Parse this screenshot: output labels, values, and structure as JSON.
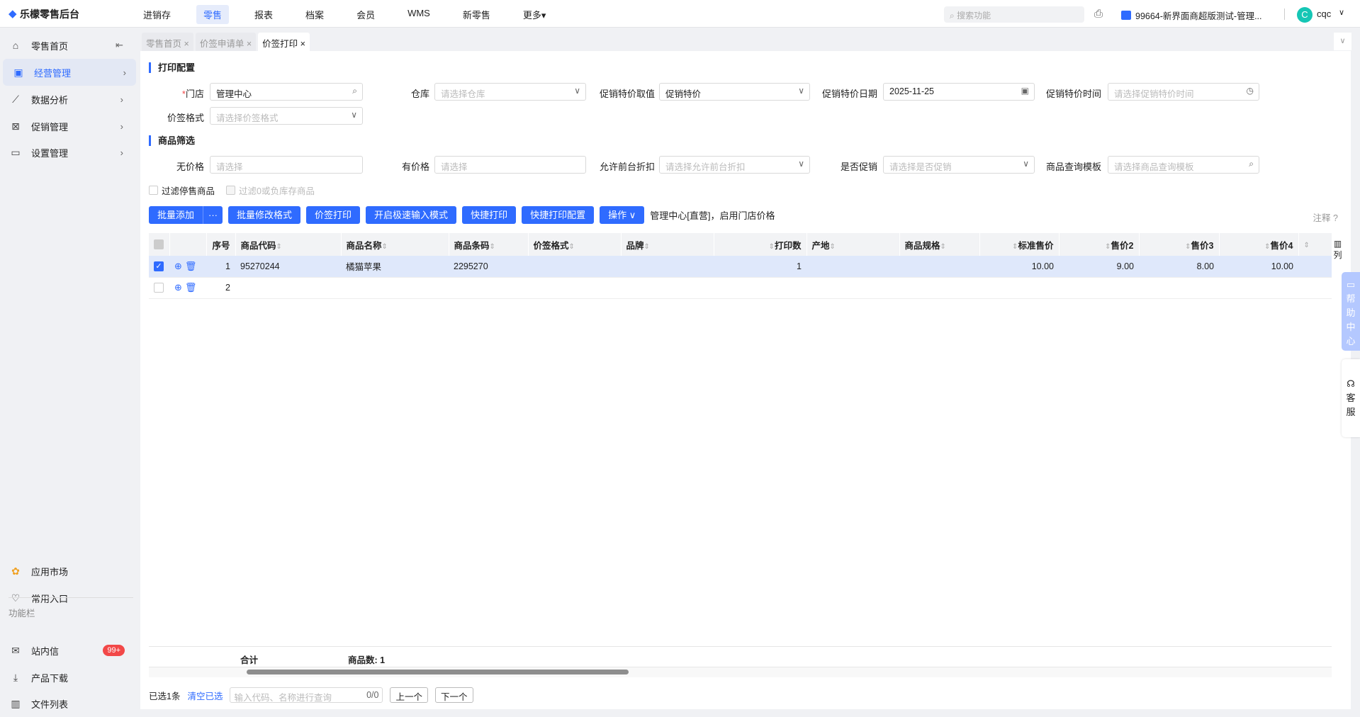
{
  "app": {
    "title": "乐檬零售后台"
  },
  "nav": [
    "进销存",
    "零售",
    "报表",
    "档案",
    "会员",
    "WMS",
    "新零售",
    "更多"
  ],
  "header": {
    "search_placeholder": "搜索功能",
    "store": "99664-新界面商超版测试-管理...",
    "user": "cqc",
    "avatar_letter": "C"
  },
  "sidebar": {
    "items": [
      "零售首页",
      "经营管理",
      "数据分析",
      "促销管理",
      "设置管理"
    ],
    "bottom": [
      "应用市场",
      "常用入口"
    ],
    "section_label": "功能栏",
    "func": [
      "站内信",
      "产品下载",
      "文件列表"
    ],
    "badge": "99+"
  },
  "tabs": [
    "零售首页",
    "价签申请单",
    "价签打印"
  ],
  "print_config": {
    "title": "打印配置",
    "store_label": "门店",
    "store_value": "管理中心",
    "warehouse_label": "仓库",
    "warehouse_placeholder": "请选择仓库",
    "promo_value_label": "促销特价取值",
    "promo_value": "促销特价",
    "promo_date_label": "促销特价日期",
    "promo_date": "2025-11-25",
    "promo_time_label": "促销特价时间",
    "promo_time_placeholder": "请选择促销特价时间",
    "format_label": "价签格式",
    "format_placeholder": "请选择价签格式"
  },
  "filter": {
    "title": "商品筛选",
    "no_price_label": "无价格",
    "no_price_placeholder": "请选择",
    "has_price_label": "有价格",
    "has_price_placeholder": "请选择",
    "discount_label": "允许前台折扣",
    "discount_placeholder": "请选择允许前台折扣",
    "promo_label": "是否促销",
    "promo_placeholder": "请选择是否促销",
    "template_label": "商品查询模板",
    "template_placeholder": "请选择商品查询模板",
    "cb1": "过滤停售商品",
    "cb2": "过滤0或负库存商品"
  },
  "toolbar": {
    "batch_add": "批量添加",
    "more": "···",
    "batch_format": "批量修改格式",
    "print": "价签打印",
    "fast_input": "开启极速输入模式",
    "quick_print": "快捷打印",
    "quick_config": "快捷打印配置",
    "ops": "操作",
    "info": "管理中心[直营]，启用门店价格",
    "note": "注释"
  },
  "table": {
    "columns": [
      "序号",
      "商品代码",
      "商品名称",
      "商品条码",
      "价签格式",
      "品牌",
      "打印数",
      "产地",
      "商品规格",
      "标准售价",
      "售价2",
      "售价3",
      "售价4"
    ],
    "rows": [
      {
        "seq": "1",
        "code": "95270244",
        "name": "橘猫苹果",
        "barcode": "2295270",
        "format": "",
        "brand": "",
        "qty": "1",
        "origin": "",
        "spec": "",
        "std": "10.00",
        "p2": "9.00",
        "p3": "8.00",
        "p4": "10.00",
        "selected": true
      },
      {
        "seq": "2",
        "code": "",
        "name": "",
        "barcode": "",
        "format": "",
        "brand": "",
        "qty": "",
        "origin": "",
        "spec": "",
        "std": "",
        "p2": "",
        "p3": "",
        "p4": "",
        "selected": false
      }
    ],
    "column_btn": "列",
    "sum_label": "合计",
    "count_label": "商品数: 1"
  },
  "footer": {
    "selected": "已选1条",
    "clear": "清空已选",
    "query_placeholder": "输入代码、名称进行查询",
    "query_count": "0/0",
    "prev": "上一个",
    "next": "下一个"
  },
  "side_float": {
    "help": "帮助中心",
    "service": "客服"
  }
}
